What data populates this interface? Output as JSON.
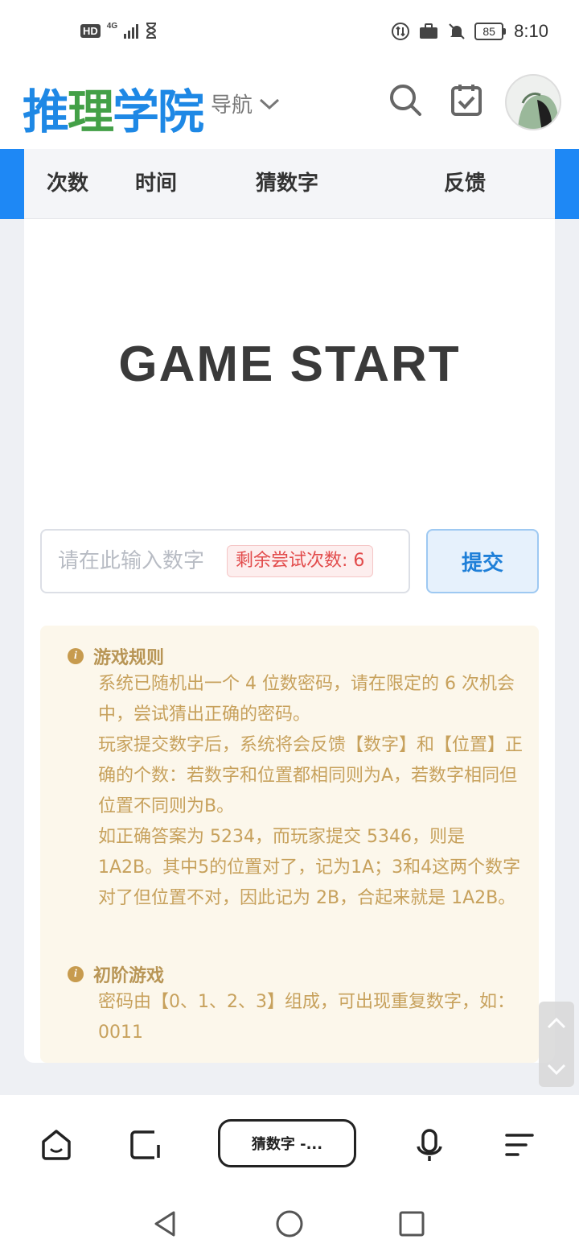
{
  "status_bar": {
    "hd": "HD",
    "network": "4G",
    "battery": "85",
    "time": "8:10"
  },
  "header": {
    "logo_chars": [
      "推",
      "理",
      "学",
      "院"
    ],
    "nav_label": "导航"
  },
  "table_header": {
    "columns": [
      "次数",
      "时间",
      "猜数字",
      "反馈"
    ]
  },
  "game": {
    "banner": "GAME START",
    "input_placeholder": "请在此输入数字",
    "remaining_label": "剩余尝试次数: 6",
    "submit_label": "提交"
  },
  "rules": {
    "section1_title": "游戏规则",
    "section1_paragraphs": [
      "系统已随机出一个 4 位数密码，请在限定的 6 次机会中，尝试猜出正确的密码。",
      "玩家提交数字后，系统将会反馈【数字】和【位置】正确的个数：若数字和位置都相同则为A，若数字相同但位置不同则为B。",
      "如正确答案为 5234，而玩家提交 5346，则是 1A2B。其中5的位置对了，记为1A；3和4这两个数字对了但位置不对，因此记为 2B，合起来就是 1A2B。"
    ],
    "section2_title": "初阶游戏",
    "section2_paragraph": "密码由【0、1、2、3】组成，可出现重复数字，如：0011"
  },
  "browser_bar": {
    "tab_label": "猜数字 -..."
  }
}
